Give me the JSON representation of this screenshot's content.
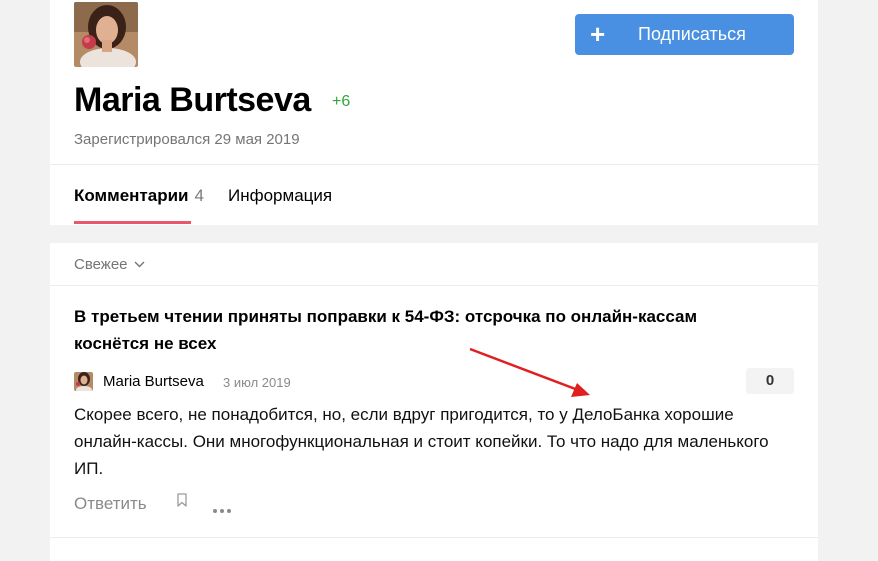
{
  "profile": {
    "name": "Maria Burtseva",
    "karma": "+6",
    "registered": "Зарегистрировался 29 мая 2019",
    "subscribe_label": "Подписаться"
  },
  "tabs": [
    {
      "label": "Комментарии",
      "count": "4",
      "active": true
    },
    {
      "label": "Информация",
      "active": false
    }
  ],
  "sort": {
    "label": "Свежее"
  },
  "comment": {
    "article_title": "В третьем чтении приняты поправки к 54-ФЗ: отсрочка по онлайн-кассам коснётся не всех",
    "author": "Maria Burtseva",
    "date": "3 июл 2019",
    "votes": "0",
    "text": "Скорее всего, не понадобится, но, если вдруг пригодится, то у ДелоБанка хорошие онлайн-кассы. Они многофункциональная и стоит копейки. То что надо для маленького ИП.",
    "reply_label": "Ответить"
  },
  "colors": {
    "accent": "#4a90e2",
    "karma": "#2ea83a",
    "tab_underline": "#e8576a",
    "annotation": "#e02020"
  },
  "icons": {
    "subscribe": "plus-icon",
    "sort": "chevron-down-icon",
    "bookmark": "bookmark-icon",
    "more": "more-icon"
  }
}
